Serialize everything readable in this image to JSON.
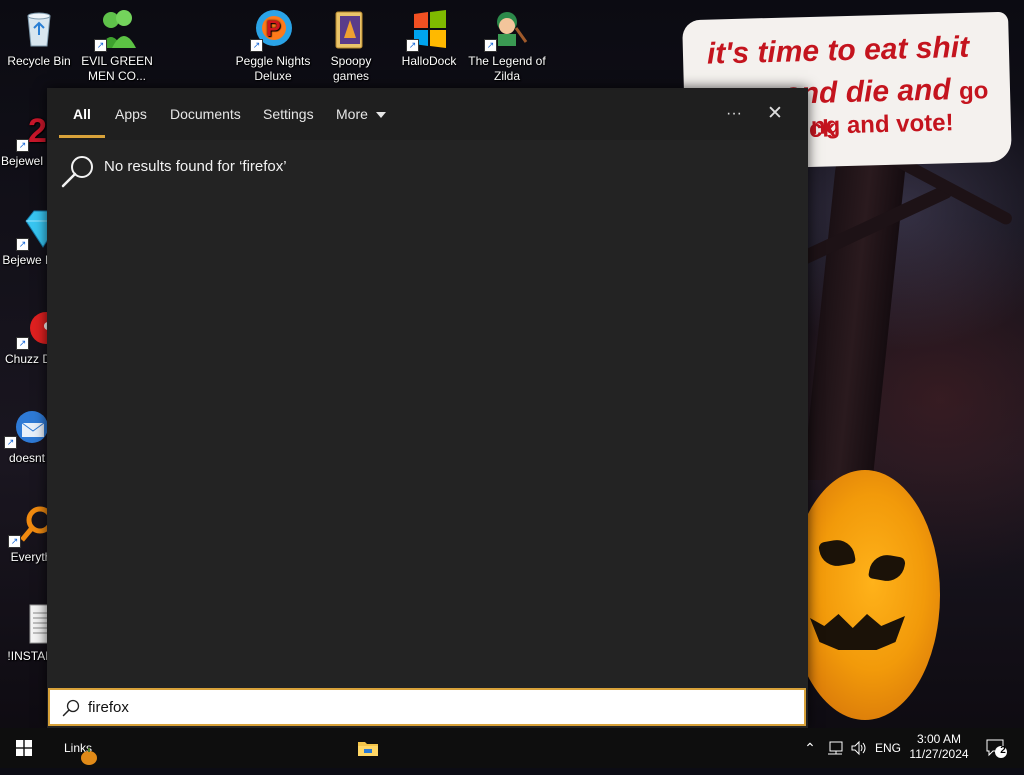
{
  "desktop": {
    "icons": [
      {
        "label": "Recycle Bin",
        "icon": "recycle-bin-icon"
      },
      {
        "label": "EVIL GREEN MEN CO...",
        "icon": "green-men-icon"
      },
      {
        "label": "Peggle Nights Deluxe",
        "icon": "peggle-icon"
      },
      {
        "label": "Spoopy games",
        "icon": "folder-icon"
      },
      {
        "label": "HalloDock",
        "icon": "windows-logo-icon"
      },
      {
        "label": "The Legend of Zilda",
        "icon": "zilda-icon"
      },
      {
        "label": "Bejewel Delux",
        "icon": "bejeweled-2-icon"
      },
      {
        "label": "Bejewe Delux",
        "icon": "bejeweled-gem-icon"
      },
      {
        "label": "Chuzz Delux",
        "icon": "chuzzle-icon"
      },
      {
        "label": "doesnt",
        "icon": "thunderbird-icon"
      },
      {
        "label": "Everyth",
        "icon": "everything-search-icon"
      },
      {
        "label": "!INSTALL",
        "icon": "text-file-icon"
      }
    ],
    "wallpaper_sign": {
      "line1": "it's time to eat shit",
      "line2a": "and die and",
      "line2b": "go trick",
      "line3": "ng and vote!"
    }
  },
  "search": {
    "tabs": [
      {
        "label": "All"
      },
      {
        "label": "Apps"
      },
      {
        "label": "Documents"
      },
      {
        "label": "Settings"
      },
      {
        "label": "More"
      }
    ],
    "more_label": "More",
    "options_glyph": "···",
    "close_glyph": "✕",
    "no_results_text": "No results found for ‘firefox’",
    "query": "firefox",
    "accent_color": "#d8a23a"
  },
  "taskbar": {
    "start_icon": "windows-start-icon",
    "links_label": "Links",
    "file_explorer_icon": "file-explorer-icon",
    "language": "ENG",
    "time": "3:00 AM",
    "date": "11/27/2024",
    "notification_count": "2"
  }
}
